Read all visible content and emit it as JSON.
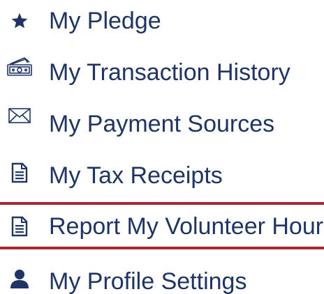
{
  "colors": {
    "text": "#1f3466",
    "highlight_border": "#a62a35"
  },
  "menu": {
    "items": [
      {
        "label": "My Pledge",
        "icon": "star-icon"
      },
      {
        "label": "My Transaction History",
        "icon": "money-icon"
      },
      {
        "label": "My Payment Sources",
        "icon": "envelope-icon"
      },
      {
        "label": "My Tax Receipts",
        "icon": "document-icon"
      },
      {
        "label": "Report My Volunteer Hours",
        "icon": "document-icon",
        "selected": true
      },
      {
        "label": "My Profile Settings",
        "icon": "user-icon"
      }
    ]
  }
}
